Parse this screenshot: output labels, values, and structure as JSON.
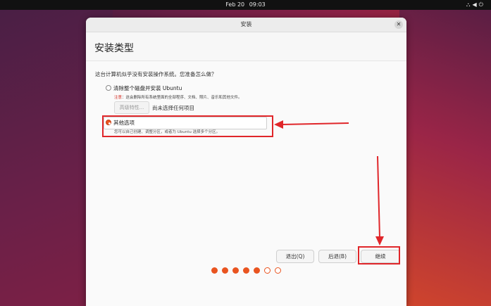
{
  "topbar": {
    "date": "Feb 20",
    "time": "09:03",
    "tray_icons": "network-icon volume-icon power-icon"
  },
  "window": {
    "title": "安装"
  },
  "page": {
    "title": "安装类型",
    "question": "这台计算机似乎没有安装操作系统。您准备怎么做？"
  },
  "options": {
    "erase": {
      "label": "清除整个磁盘并安装 Ubuntu",
      "warning_prefix": "注意",
      "warning_text": "：这会删除所有系统里面的全部程序、文档、照片、音乐和其他文件。",
      "advanced_button": "高级特性...",
      "advanced_status": "尚未选择任何项目",
      "selected": false
    },
    "other": {
      "label": "其他选项",
      "description": "您可以自己创建、调整分区，或者为 Ubuntu 选择多个分区。",
      "selected": true
    }
  },
  "buttons": {
    "quit": "退出(Q)",
    "back": "后退(B)",
    "continue": "继续"
  },
  "progress": {
    "total_steps": 7,
    "completed_steps": 5
  },
  "colors": {
    "accent": "#e95420",
    "annotation": "#e0262a"
  }
}
